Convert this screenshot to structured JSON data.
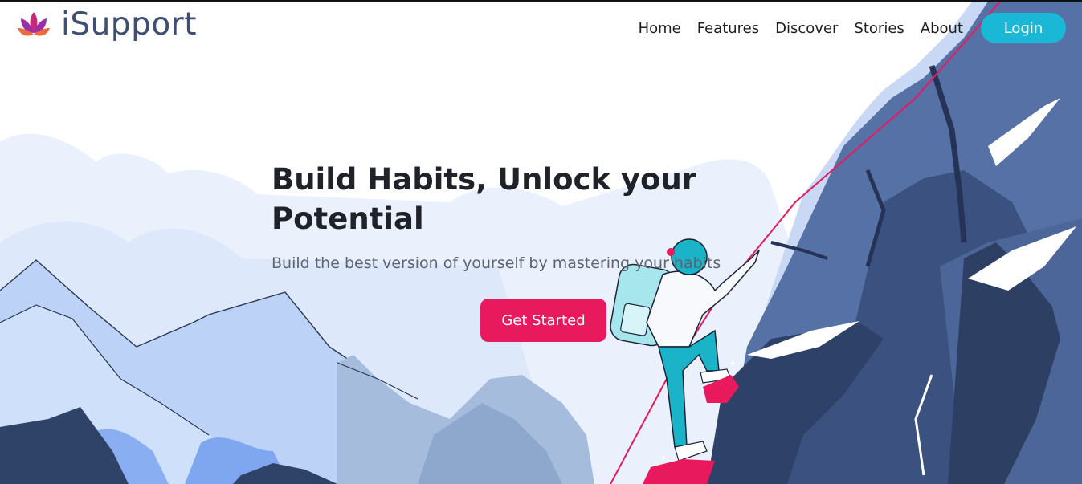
{
  "brand": {
    "name": "iSupport",
    "logo_icon": "lotus-icon"
  },
  "nav": {
    "items": [
      "Home",
      "Features",
      "Discover",
      "Stories",
      "About"
    ],
    "login_label": "Login"
  },
  "hero": {
    "title": "Build Habits, Unlock your Potential",
    "subtitle": "Build the best version of yourself by mastering your habits",
    "cta_label": "Get Started"
  },
  "colors": {
    "brand_text": "#3f4f71",
    "login_bg": "#1bb7d6",
    "cta_bg": "#e8195d",
    "mountain_dark": "#3d5580",
    "sky_light": "#e8f0fd"
  }
}
